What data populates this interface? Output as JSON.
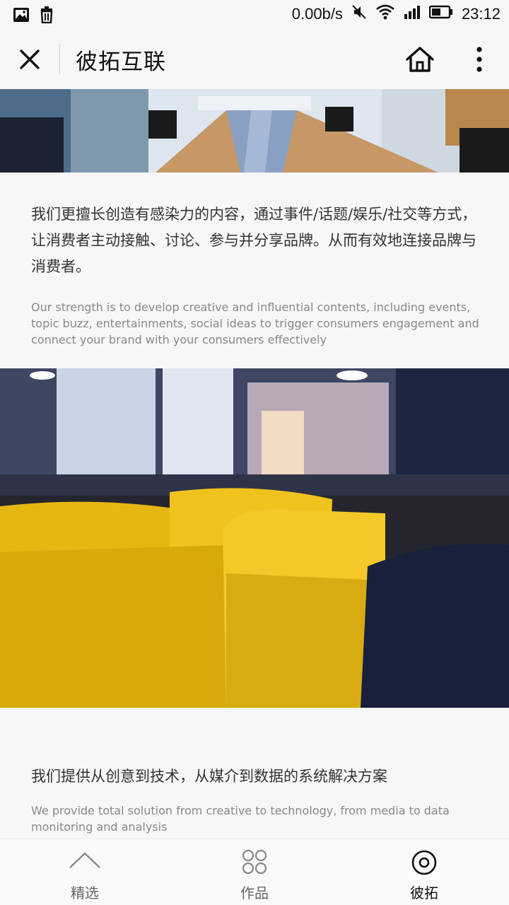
{
  "status_bar": {
    "net_speed": "0.00b/s",
    "time": "23:12",
    "left_icons": [
      "image-icon",
      "trash-icon"
    ],
    "right_icons": [
      "mute-icon",
      "wifi-icon",
      "signal-icon",
      "battery-icon"
    ]
  },
  "titlebar": {
    "title": "彼拓互联",
    "close_icon": "close-icon",
    "home_icon": "home-icon",
    "more_icon": "more-vertical-icon"
  },
  "sections": [
    {
      "zh": "我们更擅长创造有感染力的内容，通过事件/话题/娱乐/社交等方式，让消费者主动接触、讨论、参与并分享品牌。从而有效地连接品牌与消费者。",
      "en": "Our strength is to develop creative and influential contents, including events, topic buzz, entertainments, social ideas to trigger consumers engagement and connect your brand with your consumers effectively"
    },
    {
      "zh": "我们提供从创意到技术，从媒介到数据的系统解决方案",
      "en": "We provide total solution from creative to technology, from media to data monitoring and analysis"
    }
  ],
  "bottom_nav": [
    {
      "label": "精选",
      "icon": "chevron-up-icon",
      "active": false
    },
    {
      "label": "作品",
      "icon": "grid-circles-icon",
      "active": false
    },
    {
      "label": "彼拓",
      "icon": "target-circle-icon",
      "active": true
    }
  ],
  "colors": {
    "background": "#f7f7f9",
    "text_primary": "#333333",
    "text_secondary": "#888888",
    "accent_yellow": "#f2c418"
  }
}
